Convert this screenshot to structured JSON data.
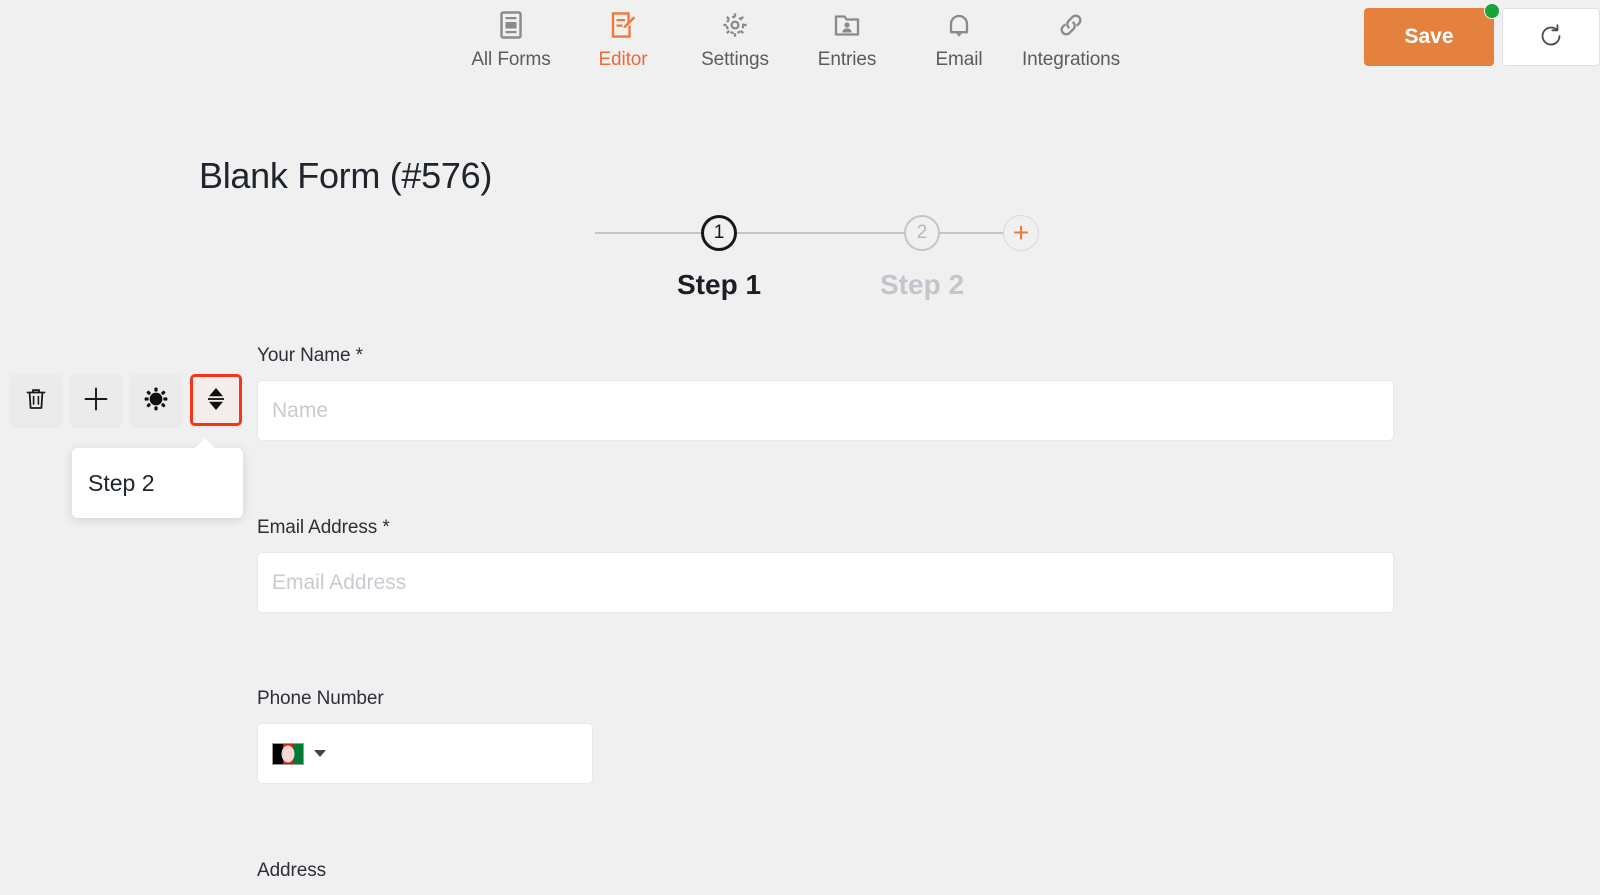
{
  "topnav": {
    "items": [
      {
        "label": "All Forms",
        "icon": "forms-list-icon",
        "active": false
      },
      {
        "label": "Editor",
        "icon": "editor-pencil-icon",
        "active": true
      },
      {
        "label": "Settings",
        "icon": "gear-icon",
        "active": false
      },
      {
        "label": "Entries",
        "icon": "entries-folder-person-icon",
        "active": false
      },
      {
        "label": "Email",
        "icon": "bell-icon",
        "active": false
      },
      {
        "label": "Integrations",
        "icon": "link-chain-icon",
        "active": false
      }
    ]
  },
  "actions": {
    "save_label": "Save",
    "save_color": "#e4813f",
    "unsaved_dot_color": "#19a33b",
    "revert_icon": "revert-arrow-icon"
  },
  "form": {
    "title": "Blank Form (#576)"
  },
  "steps": {
    "nodes": [
      {
        "number": "1",
        "label": "Step 1",
        "state": "active"
      },
      {
        "number": "2",
        "label": "Step 2",
        "state": "inactive"
      }
    ],
    "add_step_icon": "plus-icon",
    "add_step_color": "#ee7939"
  },
  "field_toolbar": {
    "buttons": [
      {
        "name": "delete-field-button",
        "icon": "trash-icon",
        "selected": false
      },
      {
        "name": "add-field-button",
        "icon": "plus-icon",
        "selected": false
      },
      {
        "name": "field-settings-button",
        "icon": "gear-filled-icon",
        "selected": false
      },
      {
        "name": "move-field-button",
        "icon": "up-down-arrows-icon",
        "selected": true
      }
    ],
    "selection_color": "#f6341a"
  },
  "move_popover": {
    "options": [
      "Step 2"
    ]
  },
  "fields": [
    {
      "label": "Your Name",
      "required": true,
      "required_mark": "*",
      "placeholder": "Name",
      "type": "text"
    },
    {
      "label": "Email Address",
      "required": true,
      "required_mark": "*",
      "placeholder": "Email Address",
      "type": "email"
    },
    {
      "label": "Phone Number",
      "required": false,
      "required_mark": "",
      "placeholder": "",
      "type": "phone",
      "country_flag": "afghanistan-flag-icon"
    },
    {
      "label": "Address",
      "required": false,
      "required_mark": "",
      "placeholder": "",
      "type": "address"
    }
  ]
}
